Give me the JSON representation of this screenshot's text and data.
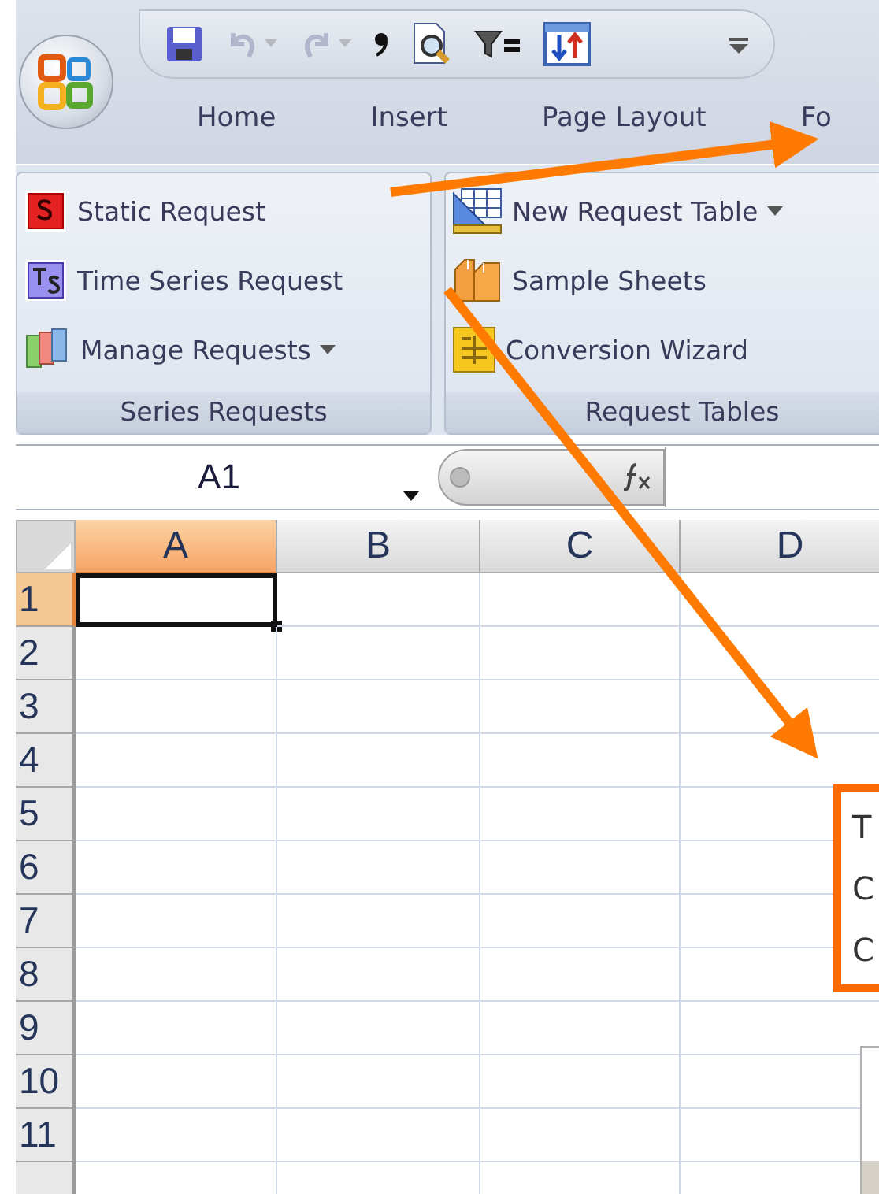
{
  "quick_access_toolbar": {
    "items": [
      {
        "kind": "save",
        "disabled": false
      },
      {
        "kind": "undo",
        "disabled": true
      },
      {
        "kind": "redo",
        "disabled": true
      },
      {
        "kind": "comma",
        "disabled": false
      },
      {
        "kind": "preview",
        "disabled": false
      },
      {
        "kind": "filter",
        "disabled": false
      },
      {
        "kind": "sort",
        "disabled": false
      }
    ]
  },
  "tabs": [
    {
      "label": "Home",
      "selected": false
    },
    {
      "label": "Insert",
      "selected": false
    },
    {
      "label": "Page Layout",
      "selected": false
    },
    {
      "label": "Fo",
      "selected": false
    }
  ],
  "ribbon_groups": [
    {
      "title": "Series Requests",
      "items": [
        {
          "label": "Static Request",
          "kind": "static",
          "dropdown": false
        },
        {
          "label": "Time Series Request",
          "kind": "timeseries",
          "dropdown": false
        },
        {
          "label": "Manage Requests",
          "kind": "manage",
          "dropdown": true
        }
      ]
    },
    {
      "title": "Request Tables",
      "items": [
        {
          "label": "New Request Table",
          "kind": "table",
          "dropdown": true
        },
        {
          "label": "Sample Sheets",
          "kind": "books",
          "dropdown": false
        },
        {
          "label": "Conversion Wizard",
          "kind": "wizard",
          "dropdown": false
        }
      ]
    }
  ],
  "name_box": {
    "value": "A1"
  },
  "sheet": {
    "columns": [
      {
        "label": "A",
        "selected": true
      },
      {
        "label": "B",
        "selected": false
      },
      {
        "label": "C",
        "selected": false
      },
      {
        "label": "D",
        "selected": false
      }
    ],
    "rows": [
      {
        "label": "1",
        "selected": true
      },
      {
        "label": "2",
        "selected": false
      },
      {
        "label": "3",
        "selected": false
      },
      {
        "label": "4",
        "selected": false
      },
      {
        "label": "5",
        "selected": false
      },
      {
        "label": "6",
        "selected": false
      },
      {
        "label": "7",
        "selected": false
      },
      {
        "label": "8",
        "selected": false
      },
      {
        "label": "9",
        "selected": false
      },
      {
        "label": "10",
        "selected": false
      },
      {
        "label": "11",
        "selected": false
      }
    ]
  },
  "callout": {
    "lines": [
      "T",
      "C",
      "C"
    ]
  }
}
